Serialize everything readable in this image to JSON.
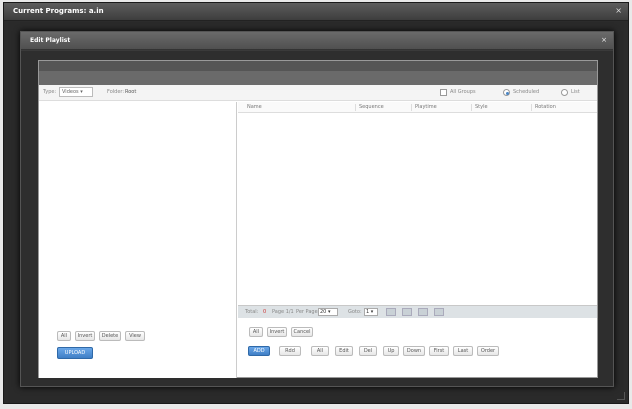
{
  "outer_window": {
    "title": "Current Programs: a.in",
    "close": "×"
  },
  "dialog": {
    "title": "Edit Playlist",
    "close": "×"
  },
  "filters": {
    "type_label": "Type:",
    "type_value": "Videos ▾",
    "folder_label": "Folder:",
    "folder_value": "Root",
    "all_groups_label": "All Groups",
    "by_group_label": "Scheduled",
    "list_label": "List"
  },
  "table": {
    "columns": [
      "Name",
      "Sequence",
      "Playtime",
      "Style",
      "Rotation"
    ]
  },
  "pager": {
    "total_label": "Total:",
    "total_value": "0",
    "page_label": "Page 1/1",
    "per_page_label": "Per Page",
    "per_page_value": "20 ▾",
    "goto_label": "Goto:",
    "goto_value": "1 ▾",
    "nav": [
      "|◀",
      "◀",
      "▶",
      "▶|"
    ]
  },
  "left_buttons": [
    "All",
    "Invert",
    "Delete",
    "View"
  ],
  "upload_label": "UPLOAD",
  "right_buttons_row1": [
    "All",
    "Invert",
    "Cancel"
  ],
  "right_buttons_row2": [
    "ADD",
    "Rdd",
    "All",
    "Edit",
    "Del",
    "Up",
    "Down",
    "First",
    "Last",
    "Order"
  ],
  "colors": {
    "accent": "#3f7fc6",
    "window_dark": "#2b2b2b"
  }
}
